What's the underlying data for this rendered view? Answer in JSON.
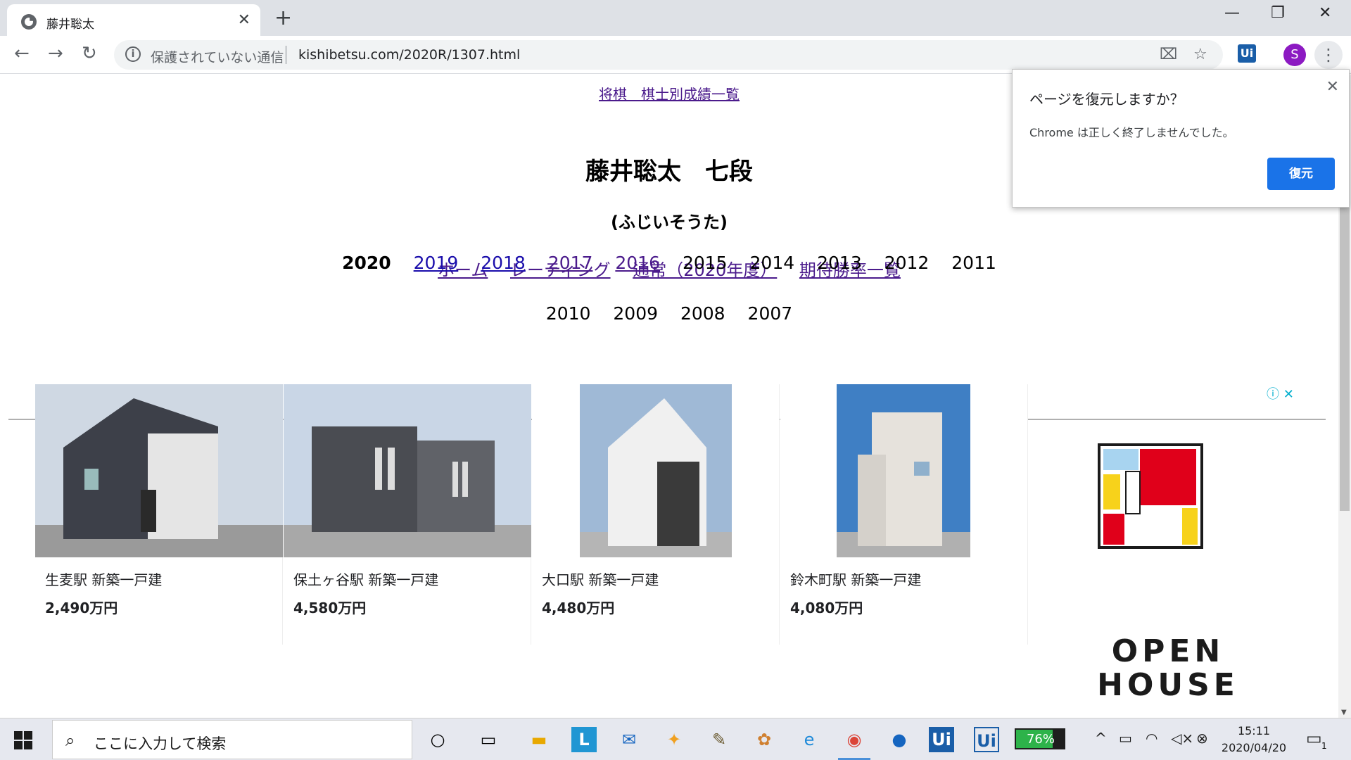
{
  "browser": {
    "tab_title": "藤井聡太",
    "security_label": "保護されていない通信",
    "url": "kishibetsu.com/2020R/1307.html",
    "profile_initial": "S",
    "ext_label": "Ui"
  },
  "page": {
    "top_link": "将棋　棋士別成績一覧",
    "heading": "藤井聡太　七段",
    "reading": "(ふじいそうた)",
    "nav_links": [
      "ホーム",
      "レーティング",
      "通常（2020年度）",
      "期待勝率一覧"
    ],
    "years_current": "2020",
    "years_linked": [
      "2019",
      "2018",
      "2017",
      "2016"
    ],
    "years_plain_row1": [
      "2015",
      "2014",
      "2013",
      "2012",
      "2011"
    ],
    "years_plain_row2": [
      "2010",
      "2009",
      "2008",
      "2007"
    ]
  },
  "ads": [
    {
      "caption": "生麦駅 新築一戸建",
      "price": "2,490万円"
    },
    {
      "caption": "保土ヶ谷駅 新築一戸建",
      "price": "4,580万円"
    },
    {
      "caption": "大口駅 新築一戸建",
      "price": "4,480万円"
    },
    {
      "caption": "鈴木町駅 新築一戸建",
      "price": "4,080万円"
    }
  ],
  "ad_brand": {
    "line1": "OPEN",
    "line2": "HOUSE"
  },
  "popup": {
    "title": "ページを復元しますか？",
    "message": "Chrome は正しく終了しませんでした。",
    "button": "復元"
  },
  "taskbar": {
    "search_placeholder": "ここに入力して検索",
    "battery_app": "76%",
    "battery_fraction": 0.76,
    "time": "15:11",
    "date": "2020/04/20",
    "notif_count": "1"
  }
}
